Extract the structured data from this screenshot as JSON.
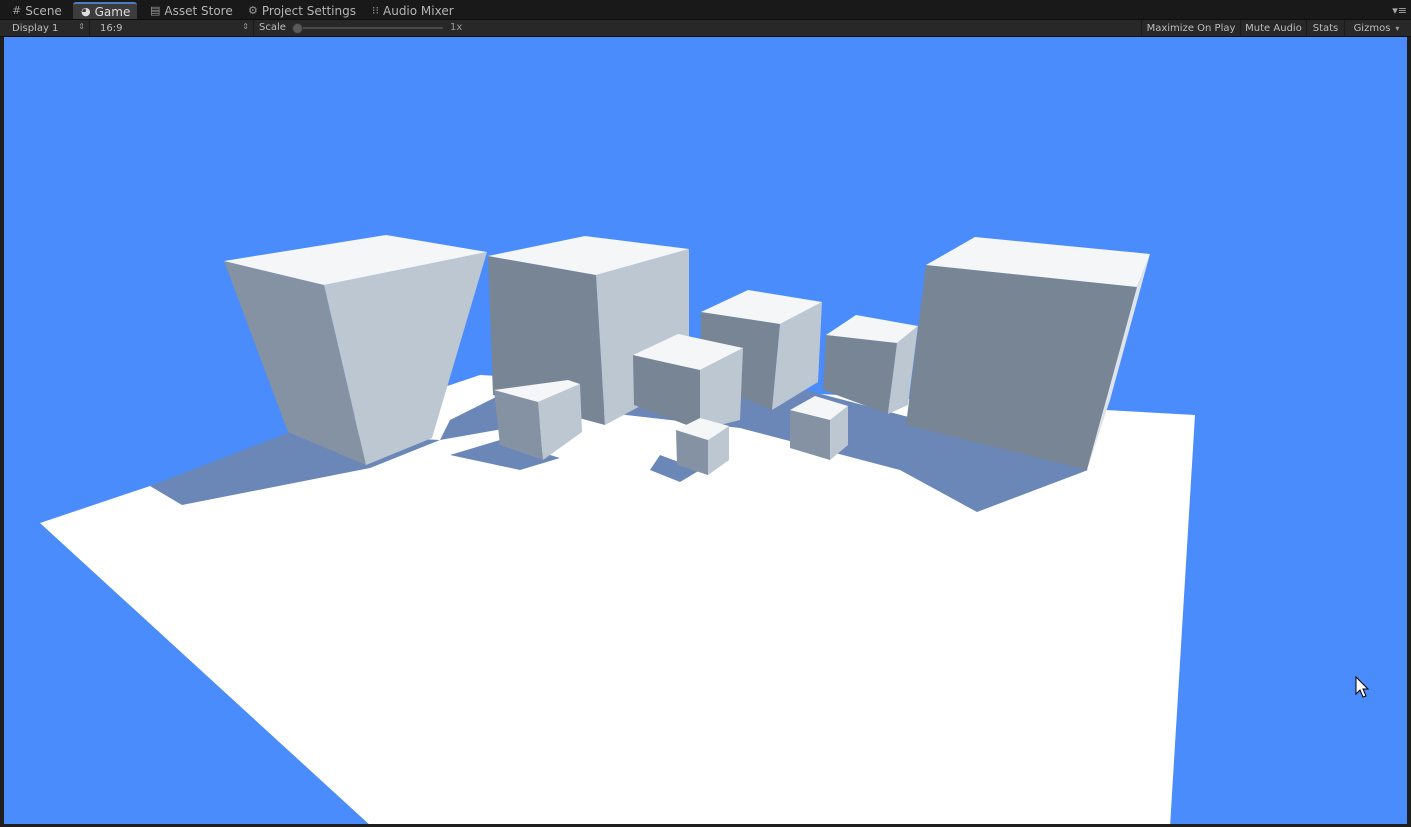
{
  "tabs": [
    {
      "label": "Scene",
      "icon": "scene-grid-icon"
    },
    {
      "label": "Game",
      "icon": "game-pacman-icon",
      "active": true
    },
    {
      "label": "Asset Store",
      "icon": "asset-store-bag-icon"
    },
    {
      "label": "Project Settings",
      "icon": "gear-icon"
    },
    {
      "label": "Audio Mixer",
      "icon": "mixer-sliders-icon"
    }
  ],
  "toolbar": {
    "display": "Display 1",
    "aspect": "16:9",
    "scale_label": "Scale",
    "scale_value": "1x",
    "maximize_on_play": "Maximize On Play",
    "mute_audio": "Mute Audio",
    "stats": "Stats",
    "gizmos": "Gizmos"
  },
  "colors": {
    "sky": "#4a8cfb",
    "ground": "#ffffff",
    "shadow": "#6a87b8",
    "cube_top": "#f4f6f8",
    "cube_light": "#bcc7d2",
    "cube_dark": "#788595",
    "accent": "#4a7fc1"
  }
}
